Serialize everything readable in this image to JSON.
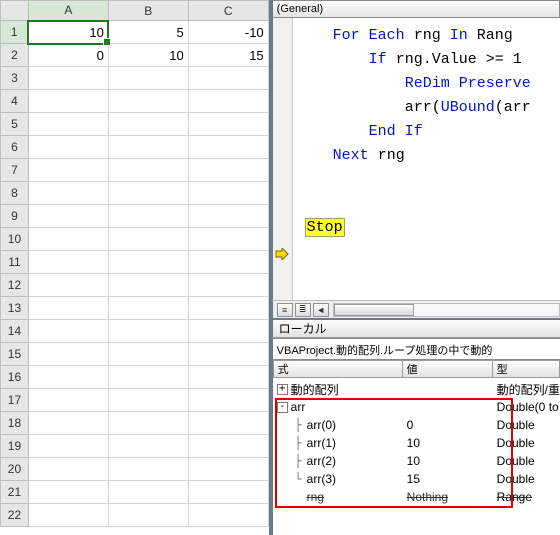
{
  "excel": {
    "columns": [
      "A",
      "B",
      "C"
    ],
    "rows": [
      "1",
      "2",
      "3",
      "4",
      "5",
      "6",
      "7",
      "8",
      "9",
      "10",
      "11",
      "12",
      "13",
      "14",
      "15",
      "16",
      "17",
      "18",
      "19",
      "20",
      "21",
      "22"
    ],
    "cells": {
      "r1c1": "10",
      "r1c2": "5",
      "r1c3": "-10",
      "r2c1": "0",
      "r2c2": "10",
      "r2c3": "15"
    },
    "selected": {
      "row": 1,
      "col": 1
    }
  },
  "vbe": {
    "proc_dropdown": "(General)",
    "code": {
      "l1": {
        "kw1": "For Each",
        "t1": " rng ",
        "kw2": "In",
        "t2": " Rang"
      },
      "l2": {
        "kw1": "If",
        "t1": " rng.Value >= 1"
      },
      "l3": {
        "kw1": "ReDim Preserve"
      },
      "l4": {
        "t1": "arr(",
        "kw1": "UBound",
        "t2": "(arr"
      },
      "l5": {
        "kw1": "End If"
      },
      "l6": {
        "kw1": "Next",
        "t1": " rng"
      },
      "stop": "Stop"
    }
  },
  "locals": {
    "title": "ローカル",
    "projpath": "VBAProject.動的配列.ループ処理の中で動的",
    "headers": {
      "expr": "式",
      "val": "値",
      "type": "型"
    },
    "rows": [
      {
        "expander": "+",
        "name": "動的配列",
        "val": "",
        "type": "動的配列/重",
        "depth": 0
      },
      {
        "expander": "-",
        "name": "arr",
        "val": "",
        "type": "Double(0 to",
        "depth": 0
      },
      {
        "expander": "├",
        "name": "arr(0)",
        "val": "0",
        "type": "Double",
        "depth": 1
      },
      {
        "expander": "├",
        "name": "arr(1)",
        "val": "10",
        "type": "Double",
        "depth": 1
      },
      {
        "expander": "├",
        "name": "arr(2)",
        "val": "10",
        "type": "Double",
        "depth": 1
      },
      {
        "expander": "└",
        "name": "arr(3)",
        "val": "15",
        "type": "Double",
        "depth": 1
      },
      {
        "expander": "",
        "name": "rng",
        "val": "Nothing",
        "type": "Range",
        "depth": 1
      }
    ]
  }
}
